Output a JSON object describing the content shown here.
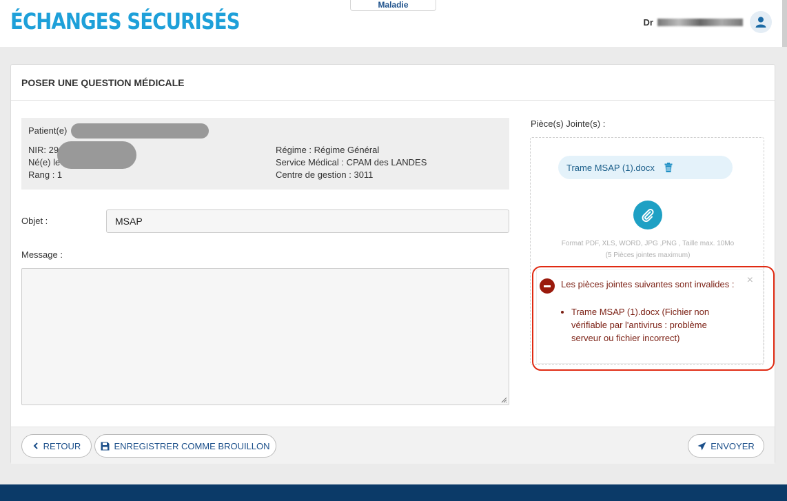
{
  "header": {
    "brand": "ÉCHANGES SÉCURISÉS",
    "top_tab": "Maladie",
    "user_prefix": "Dr"
  },
  "panel": {
    "title": "POSER UNE QUESTION MÉDICALE"
  },
  "patient": {
    "patient_label": "Patient(e)",
    "nir_label": "NIR: 29",
    "ne_label": "Né(e) le",
    "rang": "Rang : 1",
    "regime": "Régime : Régime Général",
    "service": "Service Médical : CPAM des LANDES",
    "centre": "Centre de gestion : 3011"
  },
  "form": {
    "objet_label": "Objet :",
    "objet_value": "MSAP",
    "message_label": "Message :",
    "message_value": ""
  },
  "attachments": {
    "label": "Pièce(s) Jointe(s) :",
    "file_name": "Trame MSAP (1).docx",
    "format_line1": "Format PDF, XLS, WORD, JPG ,PNG , Taille max. 10Mo",
    "format_line2": "(5 Pièces jointes maximum)"
  },
  "alert": {
    "message": "Les pièces jointes suivantes sont invalides :",
    "items": [
      "Trame MSAP (1).docx (Fichier non vérifiable par l'antivirus : problème serveur ou fichier incorrect)"
    ],
    "close": "×"
  },
  "footer": {
    "retour": "RETOUR",
    "brouillon": "ENREGISTRER COMME BROUILLON",
    "envoyer": "ENVOYER"
  },
  "colors": {
    "brand": "#1ea0d9",
    "link": "#1b4f8a",
    "alert": "#9a1a0c",
    "highlight": "#e02a12"
  }
}
